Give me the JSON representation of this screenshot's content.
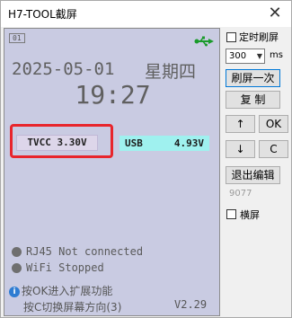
{
  "window": {
    "title": "H7-TOOL截屏",
    "close": "✕"
  },
  "lcd": {
    "page_badge": "01",
    "usb_icon": "usb-icon",
    "date": "2025-05-01",
    "weekday": "星期四",
    "time": "19:27",
    "tvcc": "TVCC 3.30V",
    "usb_label": "USB",
    "usb_value": "4.93V",
    "status": [
      {
        "text": "RJ45 Not connected"
      },
      {
        "text": "WiFi Stopped"
      }
    ],
    "info_line1": "按OK进入扩展功能",
    "info_line2": "按C切换屏幕方向(3)",
    "version": "V2.29",
    "colors": {
      "screen_bg": "#c9cbe2",
      "highlight": "#e8252c",
      "usb_bg": "#9ff1ef",
      "usb_icon": "#1a9b2b"
    }
  },
  "controls": {
    "timed_refresh_label": "定时刷屏",
    "interval_value": "300",
    "interval_unit": "ms",
    "refresh_once": "刷屏一次",
    "copy": "复 制",
    "up": "↑",
    "ok": "OK",
    "down": "↓",
    "c": "C",
    "exit_edit": "退出编辑",
    "code": "9077",
    "landscape_label": "横屏"
  }
}
